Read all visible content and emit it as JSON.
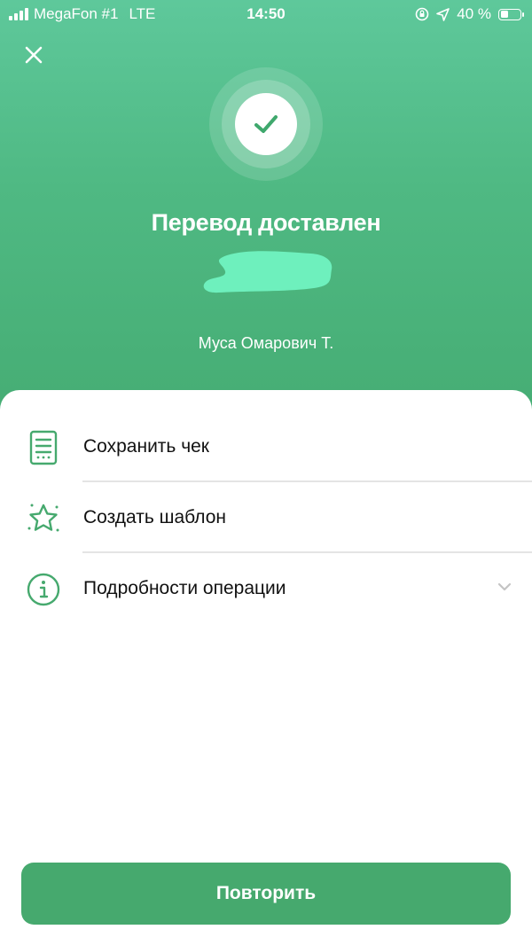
{
  "status_bar": {
    "carrier": "MegaFon #1",
    "network": "LTE",
    "time": "14:50",
    "battery": "40 %",
    "battery_level": 0.4
  },
  "header": {
    "title": "Перевод доставлен",
    "recipient": "Муса Омарович Т."
  },
  "actions": [
    {
      "label": "Сохранить чек",
      "icon": "receipt-icon"
    },
    {
      "label": "Создать шаблон",
      "icon": "star-icon"
    },
    {
      "label": "Подробности операции",
      "icon": "info-icon"
    }
  ],
  "footer": {
    "repeat_label": "Повторить"
  },
  "colors": {
    "header_green": "#4fb983",
    "accent_green": "#46a96e",
    "redaction": "#6ef0bd"
  }
}
